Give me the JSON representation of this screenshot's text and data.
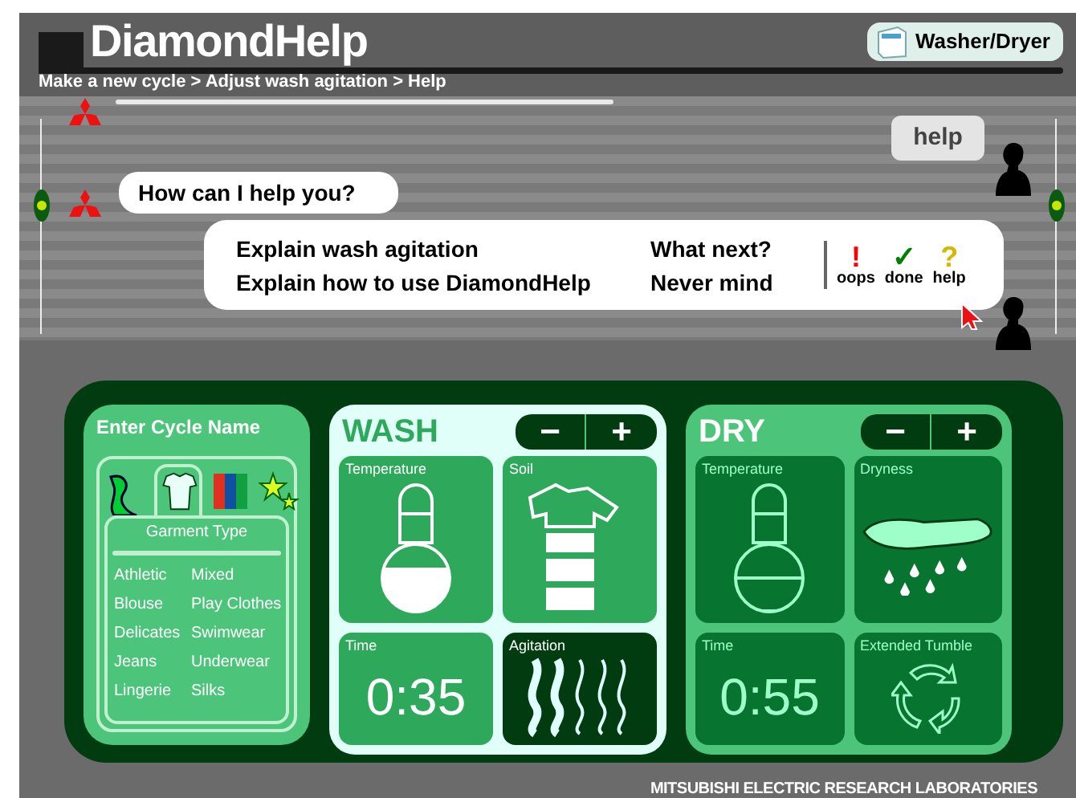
{
  "header": {
    "title": "DiamondHelp",
    "appliance": "Washer/Dryer",
    "breadcrumb": "Make a new cycle > Adjust wash agitation > Help"
  },
  "conversation": {
    "user_bubble": "help",
    "system_bubble": "How can I help you?",
    "choices": [
      {
        "text": "Explain wash agitation"
      },
      {
        "text": "What next?"
      },
      {
        "text": "Explain how to use DiamondHelp"
      },
      {
        "text": "Never mind"
      }
    ],
    "actions": [
      {
        "symbol": "!",
        "label": "oops",
        "color": "#ff0000"
      },
      {
        "symbol": "✓",
        "label": "done",
        "color": "#008000"
      },
      {
        "symbol": "?",
        "label": "help",
        "color": "#d4b800"
      }
    ]
  },
  "cycle_panel": {
    "title": "Enter Cycle Name",
    "tabs": [
      {
        "kind": "texture",
        "selected": false
      },
      {
        "kind": "shirt",
        "selected": true
      },
      {
        "kind": "colors",
        "selected": false
      },
      {
        "kind": "stars",
        "selected": false
      }
    ],
    "heading": "Garment Type",
    "garment_columns": [
      [
        "Athletic",
        "Blouse",
        "Delicates",
        "Jeans",
        "Lingerie"
      ],
      [
        "Mixed",
        "Play Clothes",
        "Swimwear",
        "Underwear",
        "Silks"
      ]
    ]
  },
  "wash": {
    "title": "WASH",
    "buttons": [
      "−",
      "+"
    ],
    "tiles": [
      {
        "kind": "temperature",
        "label": "Temperature"
      },
      {
        "kind": "soil",
        "label": "Soil"
      },
      {
        "kind": "time",
        "label": "Time",
        "value": "0:35"
      },
      {
        "kind": "agitation",
        "label": "Agitation"
      }
    ]
  },
  "dry": {
    "title": "DRY",
    "buttons": [
      "−",
      "+"
    ],
    "tiles": [
      {
        "kind": "temperature",
        "label": "Temperature"
      },
      {
        "kind": "dryness",
        "label": "Dryness"
      },
      {
        "kind": "time",
        "label": "Time",
        "value": "0:55"
      },
      {
        "kind": "tumble",
        "label": "Extended Tumble"
      }
    ]
  },
  "footer": "MITSUBISHI ELECTRIC RESEARCH LABORATORIES"
}
